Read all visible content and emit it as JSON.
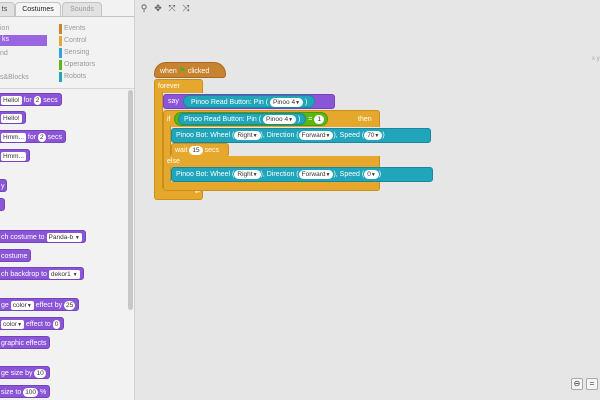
{
  "tabs": [
    {
      "label": "ts"
    },
    {
      "label": "Costumes"
    },
    {
      "label": "Sounds"
    }
  ],
  "categories_left": [
    {
      "label": "ion"
    },
    {
      "label": "ks"
    },
    {
      "label": "nd"
    },
    {
      "label": ""
    },
    {
      "label": "s&Blocks"
    }
  ],
  "categories_right": [
    {
      "label": "Events",
      "color": "#c88330"
    },
    {
      "label": "Control",
      "color": "#e6a82c"
    },
    {
      "label": "Sensing",
      "color": "#2ca5e2"
    },
    {
      "label": "Operators",
      "color": "#5cb712"
    },
    {
      "label": "Robots",
      "color": "#20a5ba"
    }
  ],
  "palette": {
    "b1": {
      "pill": "Hello!",
      "mid": "for",
      "num": "2",
      "tail": "secs"
    },
    "b2": {
      "pill": "Hello!"
    },
    "b3": {
      "pill": "Hmm...",
      "mid": "for",
      "num": "2",
      "tail": "secs"
    },
    "b4": {
      "pill": "Hmm..."
    },
    "b5": {
      "text": "y"
    },
    "b6": {
      "text": ""
    },
    "b7": {
      "text": "ch costume to",
      "pill": "Panda-b"
    },
    "b8": {
      "text": "costume"
    },
    "b9": {
      "text": "ch backdrop to",
      "pill": "dekor1"
    },
    "b10": {
      "text": "ge",
      "pill": "color",
      "mid": "effect by",
      "num": "25"
    },
    "b11": {
      "pill": "color",
      "mid": "effect to",
      "num": "0"
    },
    "b12": {
      "text": "graphic effects"
    },
    "b13": {
      "text": "ge size by",
      "num": "10"
    },
    "b14": {
      "text": "size to",
      "num": "100",
      "tail": "%"
    }
  },
  "script": {
    "hat_when": "when",
    "hat_clicked": "clicked",
    "forever": "forever",
    "say": "say",
    "read_label": "Pinoo Read Button: Pin (",
    "read_pin": "Pinoo 4",
    "read_close": ")",
    "if": "if",
    "then": "then",
    "equals": "=",
    "equals_value": "1",
    "wheel_label": "Pinoo Bot: Wheel (",
    "wheel_value": "Right",
    "direction_label": "), Direction (",
    "direction_value": "Forward",
    "speed_label": "), Speed (",
    "speed_value_1": "70",
    "speed_value_2": "0",
    "speed_close": ")",
    "wait": "wait",
    "wait_value": "15",
    "wait_secs": "secs",
    "else": "else"
  },
  "side_letters": "x y",
  "colors": {
    "looks": "#8a55d7",
    "control": "#e6a82c",
    "events": "#c88330",
    "robots": "#20a5ba",
    "operators": "#5cb712"
  }
}
